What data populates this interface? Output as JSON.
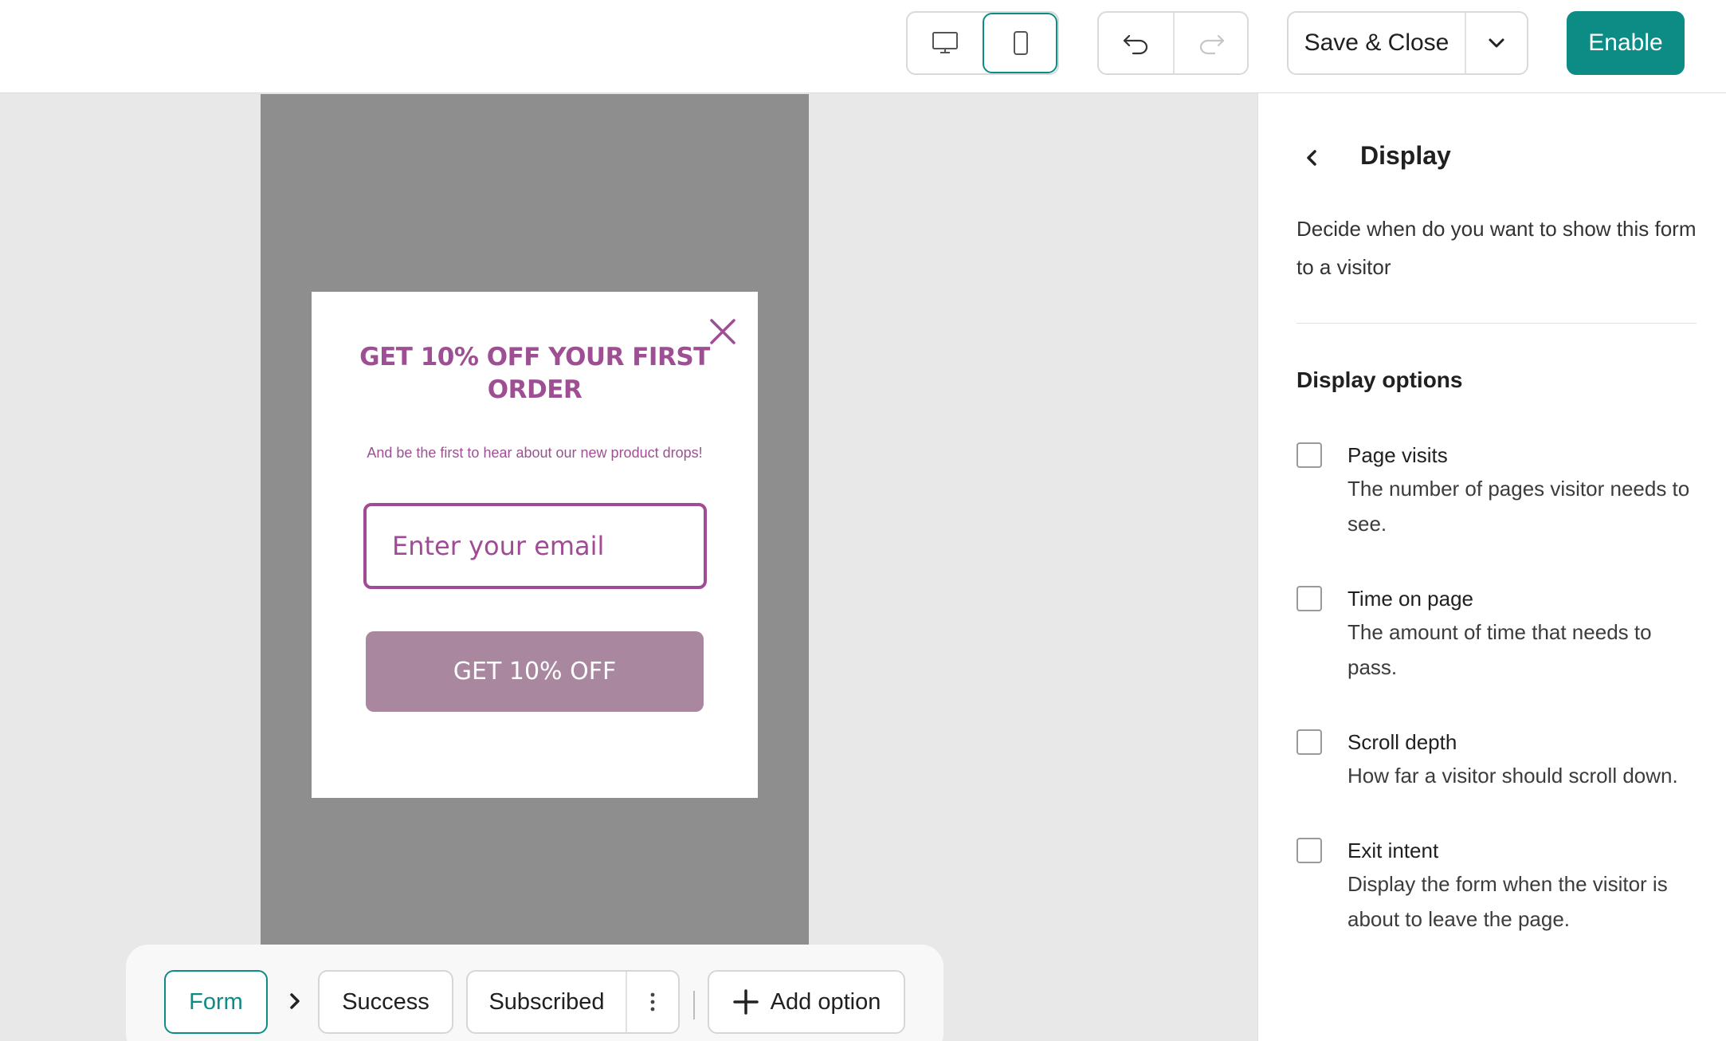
{
  "toolbar": {
    "devices": [
      {
        "icon": "desktop-icon",
        "selected": false
      },
      {
        "icon": "mobile-icon",
        "selected": true
      }
    ],
    "undo_icon": "undo-icon",
    "redo_icon": "redo-icon",
    "save_label": "Save & Close",
    "save_menu_icon": "chevron-down-icon",
    "enable_label": "Enable",
    "accent_color": "#0d8c86"
  },
  "popup": {
    "close_icon": "close-icon",
    "title": "GET 10% OFF YOUR FIRST ORDER",
    "subtitle": "And be the first to hear about our new product drops!",
    "email_placeholder": "Enter your email",
    "cta_label": "GET 10% OFF",
    "brand_color": "#9e4f93",
    "cta_color": "#a8879f"
  },
  "steps": {
    "form_label": "Form",
    "arrow_icon": "chevron-right-icon",
    "success_label": "Success",
    "subscribed_label": "Subscribed",
    "more_icon": "more-vertical-icon",
    "add_option_label": "Add option",
    "add_icon": "plus-icon"
  },
  "panel": {
    "back_icon": "chevron-left-icon",
    "title": "Display",
    "description": "Decide when do you want to show this form to a visitor",
    "section_title": "Display options",
    "options": [
      {
        "title": "Page visits",
        "description": "The number of pages visitor needs to see.",
        "checked": false
      },
      {
        "title": "Time on page",
        "description": "The amount of time that needs to pass.",
        "checked": false
      },
      {
        "title": "Scroll depth",
        "description": "How far a visitor should scroll down.",
        "checked": false
      },
      {
        "title": "Exit intent",
        "description": "Display the form when the visitor is about to leave the page.",
        "checked": false
      }
    ]
  }
}
